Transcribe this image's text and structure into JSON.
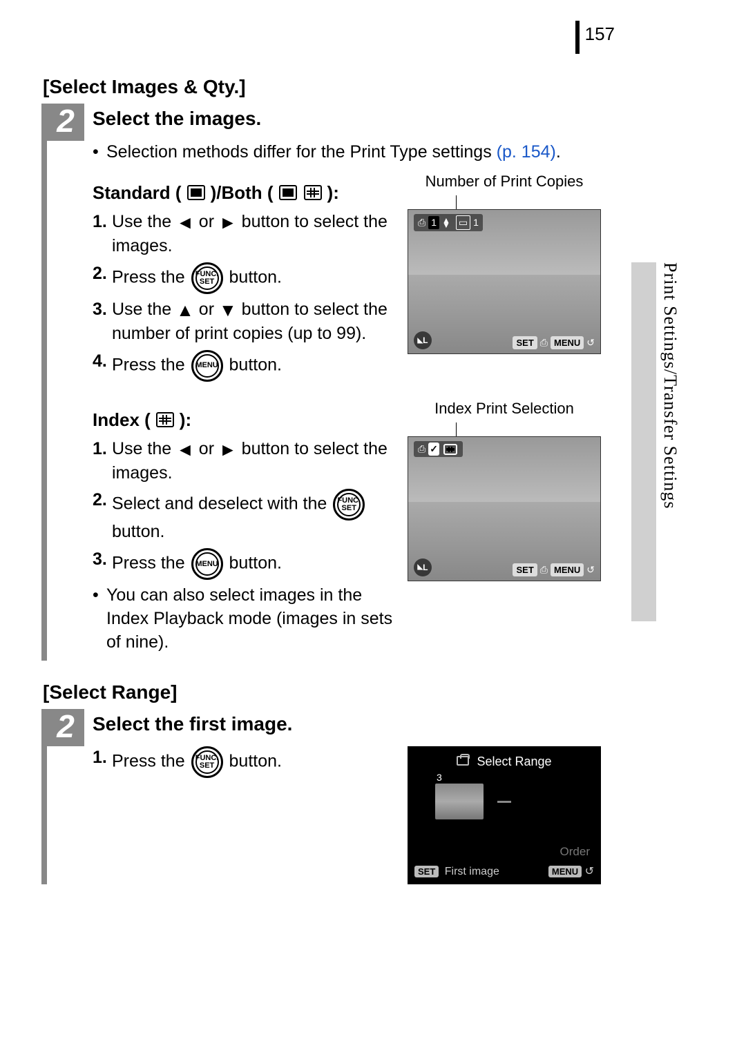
{
  "page_number": "157",
  "side_tab": "Print Settings/Transfer Settings",
  "section1": {
    "title": "[Select Images & Qty.]",
    "step_num": "2",
    "step_heading": "Select the images.",
    "intro_bullet": "Selection methods differ for the Print Type settings ",
    "intro_link": "(p. 154)",
    "intro_after": ".",
    "standard": {
      "heading_pre": "Standard (",
      "heading_mid": ")/Both (",
      "heading_post": "):",
      "caption": "Number of Print Copies",
      "items": {
        "n1": "1.",
        "t1_a": "Use the ",
        "t1_b": " or ",
        "t1_c": " button to select the images.",
        "n2": "2.",
        "t2_a": "Press the ",
        "t2_b": " button.",
        "n3": "3.",
        "t3_a": "Use the ",
        "t3_b": " or ",
        "t3_c": " button to select the number of print copies (up to 99).",
        "n4": "4.",
        "t4_a": "Press the ",
        "t4_b": " button."
      },
      "cam": {
        "top_count": "1",
        "top_right": "1",
        "bl": "L",
        "set": "SET",
        "menu": "MENU"
      }
    },
    "index": {
      "heading_pre": "Index (",
      "heading_post": "):",
      "caption": "Index Print Selection",
      "items": {
        "n1": "1.",
        "t1_a": "Use the ",
        "t1_b": " or ",
        "t1_c": " button to select the images.",
        "n2": "2.",
        "t2_a": "Select and deselect with the ",
        "t2_b": " button.",
        "n3": "3.",
        "t3_a": "Press the ",
        "t3_b": " button.",
        "note_bullet": "You can also select images in the Index Playback mode (images in sets of nine)."
      },
      "cam": {
        "check": "✓",
        "bl": "L",
        "set": "SET",
        "menu": "MENU"
      }
    }
  },
  "section2": {
    "title": "[Select Range]",
    "step_num": "2",
    "step_heading": "Select the first image.",
    "items": {
      "n1": "1.",
      "t1_a": "Press the ",
      "t1_b": " button."
    },
    "range_screen": {
      "title": "Select Range",
      "thumb_num": "3",
      "order": "Order",
      "set": "SET",
      "first": "First image",
      "menu": "MENU"
    },
    "func_set_top": "FUNC.",
    "func_set_bot": "SET",
    "menu_label": "MENU"
  },
  "buttons": {
    "func_set_top": "FUNC.",
    "func_set_bot": "SET",
    "menu": "MENU"
  }
}
